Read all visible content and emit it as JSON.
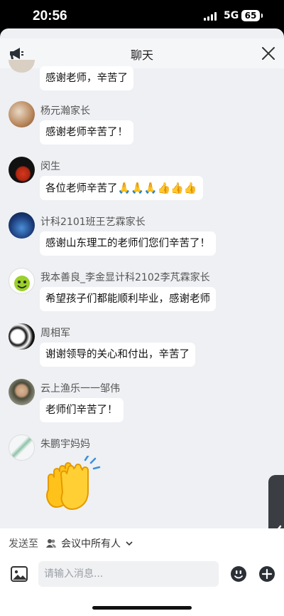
{
  "status_bar": {
    "time": "20:56",
    "network": "5G",
    "battery": "65"
  },
  "header": {
    "title": "聊天"
  },
  "messages": [
    {
      "name": "",
      "text": "感谢老师，辛苦了"
    },
    {
      "name": "杨元瀚家长",
      "text": "感谢老师辛苦了！"
    },
    {
      "name": "闵生",
      "text": "各位老师辛苦了",
      "emojis": "🙏🙏🙏👍👍👍"
    },
    {
      "name": "计科2101班王艺霖家长",
      "text": "感谢山东理工的老师们您们辛苦了！"
    },
    {
      "name": "我本善良_李金显计科2102李芃霖家长",
      "text": "希望孩子们都能顺利毕业，感谢老师"
    },
    {
      "name": "周相军",
      "text": "谢谢领导的关心和付出，辛苦了"
    },
    {
      "name": "云上渔乐一一邹伟",
      "text": "老师们辛苦了！"
    },
    {
      "name": "朱鹏宇妈妈",
      "sticker": "clapping-hands-sticker"
    }
  ],
  "footer": {
    "send_to_label": "发送至",
    "recipient": "会议中所有人",
    "input_placeholder": "请输入消息..."
  },
  "icons": [
    "megaphone-icon",
    "close-icon",
    "person-icon",
    "chevron-down-icon",
    "image-icon",
    "emoji-icon",
    "plus-icon",
    "chevron-left-icon"
  ],
  "colors": {
    "sheet_bg": "#eef0f3",
    "bubble": "#ffffff",
    "sticker": "#f5b400"
  }
}
